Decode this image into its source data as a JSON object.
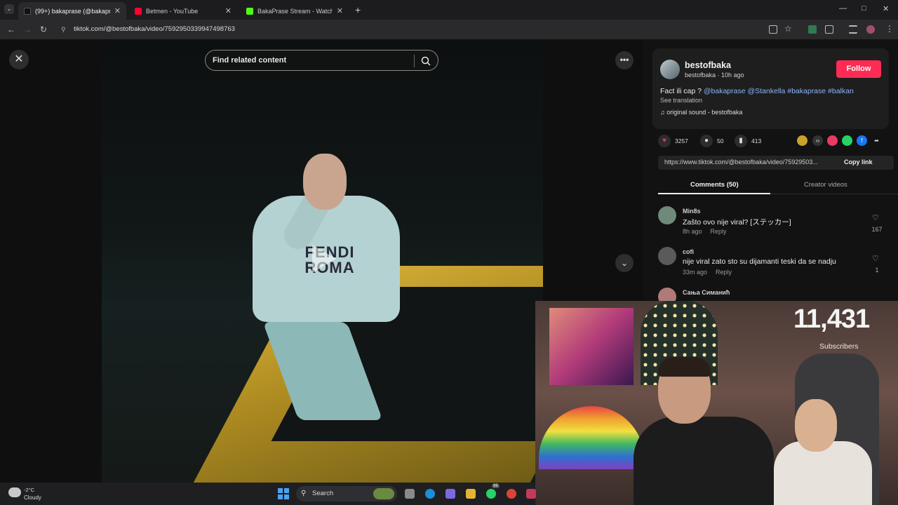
{
  "browser": {
    "tabs": [
      {
        "label": "(99+) bakaprase (@bakaprase) |",
        "active": true,
        "favicon_color": "#111111"
      },
      {
        "label": "Betmen - YouTube",
        "active": false,
        "favicon_color": "#ff0033"
      },
      {
        "label": "BakaPrase Stream - Watch Live",
        "active": false,
        "favicon_color": "#53fc18"
      }
    ],
    "new_tab": "+",
    "url": "tiktok.com/@bestofbaka/video/7592950339947498763",
    "window_controls": {
      "minimize": "—",
      "maximize": "□",
      "close": "✕"
    }
  },
  "video": {
    "search_placeholder": "Find related content",
    "hoodie_text": "FENDI\nROMA"
  },
  "post": {
    "username": "bestofbaka",
    "subline": "bestofbaka · 10h ago",
    "follow_label": "Follow",
    "caption_prefix": "Fact ili cap ? ",
    "caption_tags": "@bakaprase @Stankella #bakaprase #balkan",
    "see_translation": "See translation",
    "sound": "original sound - bestofbaka",
    "likes": "3257",
    "comments": "50",
    "saves": "413",
    "link": "https://www.tiktok.com/@bestofbaka/video/75929503...",
    "copy_link": "Copy link",
    "tab_comments": "Comments (50)",
    "tab_creator": "Creator videos"
  },
  "comments": [
    {
      "name": "Min8s",
      "text": "Zašto ovo nije viral? [ステッカー]",
      "time": "8h ago",
      "reply": "Reply",
      "likes": "167",
      "avatar_color": "#6f8a7a"
    },
    {
      "name": "cofi",
      "text": "nije viral zato sto su dijamanti teski da se nadju",
      "time": "33m ago",
      "reply": "Reply",
      "likes": "1",
      "avatar_color": "#5a5a5a"
    },
    {
      "name": "Сања Симанић",
      "text": "",
      "time": "",
      "reply": "",
      "likes": "",
      "avatar_color": "#b07a7a"
    }
  ],
  "stream": {
    "subscriber_count": "11,431",
    "subscriber_label": "Subscribers"
  },
  "taskbar": {
    "weather_temp": "-2°C",
    "weather_cond": "Cloudy",
    "search_label": "Search",
    "badge": "99"
  },
  "colors": {
    "follow": "#fe2c55",
    "hashtag": "#8ab4f8"
  }
}
